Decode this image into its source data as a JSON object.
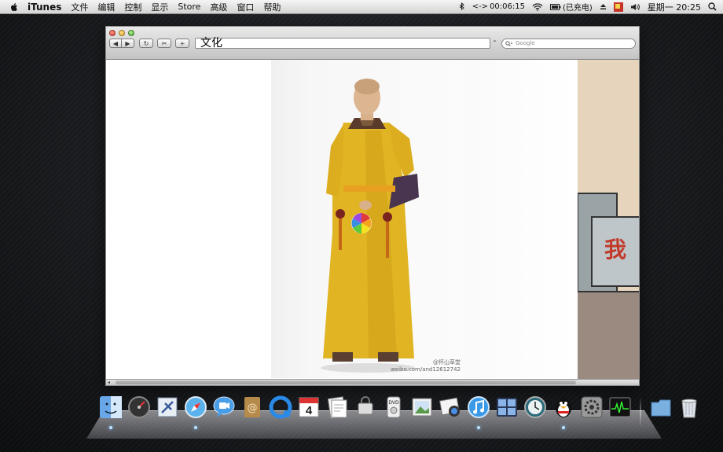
{
  "menubar": {
    "app_name": "iTunes",
    "items": [
      "文件",
      "编辑",
      "控制",
      "显示",
      "Store",
      "高级",
      "窗口",
      "帮助"
    ],
    "timer": "00:06:15",
    "battery_label": "(已充电)",
    "clock": "星期一 20:25"
  },
  "browser": {
    "url_text": "文化",
    "search_placeholder": "Google",
    "photo_watermark_line1": "@怀山草堂",
    "photo_watermark_line2": "weibo.com/and12612742",
    "cartoon_text": "我"
  },
  "dock": {
    "items": [
      {
        "name": "finder-icon",
        "running": true
      },
      {
        "name": "dashboard-icon",
        "running": false
      },
      {
        "name": "mail-icon",
        "running": false
      },
      {
        "name": "safari-icon",
        "running": true
      },
      {
        "name": "ichat-icon",
        "running": false
      },
      {
        "name": "address-book-icon",
        "running": false
      },
      {
        "name": "quicktime-icon",
        "running": false
      },
      {
        "name": "ical-icon",
        "running": false
      },
      {
        "name": "preview-icon",
        "running": false
      },
      {
        "name": "keychain-icon",
        "running": false
      },
      {
        "name": "dvd-player-icon",
        "running": false
      },
      {
        "name": "iphoto-frame-icon",
        "running": false
      },
      {
        "name": "iphoto-icon",
        "running": false
      },
      {
        "name": "itunes-icon",
        "running": true
      },
      {
        "name": "spaces-icon",
        "running": false
      },
      {
        "name": "time-machine-icon",
        "running": false
      },
      {
        "name": "qq-penguin-icon",
        "running": true
      },
      {
        "name": "system-preferences-icon",
        "running": false
      },
      {
        "name": "activity-monitor-icon",
        "running": false
      },
      {
        "name": "documents-folder-icon",
        "running": false
      },
      {
        "name": "trash-icon",
        "running": false
      }
    ],
    "ical_day": "4"
  },
  "colors": {
    "robe_yellow": "#e0b423",
    "collar_brown": "#5a3a2a"
  }
}
